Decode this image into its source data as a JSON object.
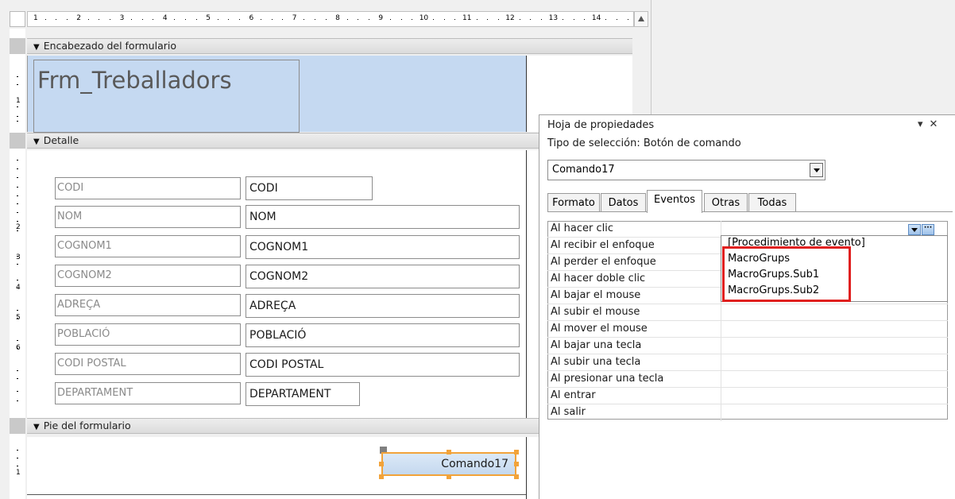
{
  "ruler": {
    "h_numbers": [
      "1",
      "2",
      "3",
      "4",
      "5",
      "6",
      "7",
      "8",
      "9",
      "10",
      "11",
      "12",
      "13",
      "14"
    ],
    "v_numbers": [
      "1",
      "2",
      "3",
      "4",
      "5",
      "6",
      "1"
    ]
  },
  "sections": {
    "header": "Encabezado del formulario",
    "detail": "Detalle",
    "footer": "Pie del formulario"
  },
  "form_title": "Frm_Treballadors",
  "fields": [
    {
      "label": "CODI",
      "value": "CODI"
    },
    {
      "label": "NOM",
      "value": "NOM"
    },
    {
      "label": "COGNOM1",
      "value": "COGNOM1"
    },
    {
      "label": "COGNOM2",
      "value": "COGNOM2"
    },
    {
      "label": "ADREÇA",
      "value": "ADREÇA"
    },
    {
      "label": "POBLACIÓ",
      "value": "POBLACIÓ"
    },
    {
      "label": "CODI POSTAL",
      "value": "CODI POSTAL"
    },
    {
      "label": "DEPARTAMENT",
      "value": "DEPARTAMENT"
    }
  ],
  "command_button": "Comando17",
  "property_sheet": {
    "title": "Hoja de propiedades",
    "collapse_glyph": "▾",
    "close_glyph": "✕",
    "selection_type": "Tipo de selección:  Botón de comando",
    "object_combo": "Comando17",
    "tabs": [
      "Formato",
      "Datos",
      "Eventos",
      "Otras",
      "Todas"
    ],
    "active_tab": "Eventos",
    "properties": [
      "Al hacer clic",
      "Al recibir el enfoque",
      "Al perder el enfoque",
      "Al hacer doble clic",
      "Al bajar el mouse",
      "Al subir el mouse",
      "Al mover el mouse",
      "Al bajar una tecla",
      "Al subir una tecla",
      "Al presionar una tecla",
      "Al entrar",
      "Al salir"
    ],
    "builder_glyph": "···",
    "dropdown_options": [
      "[Procedimiento de evento]",
      "MacroGrups",
      "MacroGrups.Sub1",
      "MacroGrups.Sub2"
    ],
    "highlight_color": "#e0201f"
  }
}
